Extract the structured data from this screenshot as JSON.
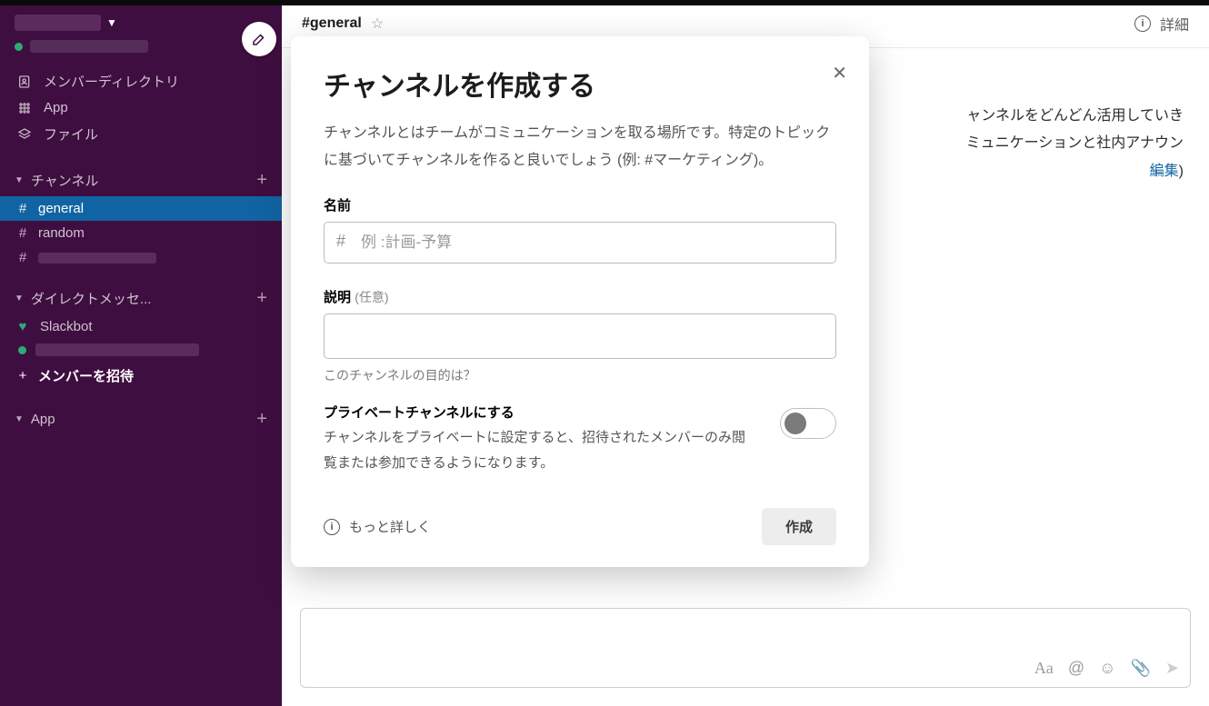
{
  "sidebar": {
    "nav": {
      "members": "メンバーディレクトリ",
      "apps": "App",
      "files": "ファイル"
    },
    "sections": {
      "channels_heading": "チャンネル",
      "dms_heading": "ダイレクトメッセ...",
      "apps_heading": "App"
    },
    "channels": [
      {
        "label": "general",
        "active": true
      },
      {
        "label": "random",
        "active": false
      },
      {
        "label": "",
        "active": false,
        "blurred": true
      }
    ],
    "dms": {
      "slackbot": "Slackbot"
    },
    "invite": "メンバーを招待"
  },
  "header": {
    "channel_name": "#general",
    "details": "詳細"
  },
  "channel_intro": {
    "line1_suffix": "ャンネルをどんどん活用していき",
    "line2_suffix": "ミュニケーションと社内アナウン",
    "edit": "編集",
    "close_paren": ")"
  },
  "composer": {
    "aa": "Aa",
    "at": "@",
    "emoji": "☺",
    "attach": "📎",
    "send": "➤"
  },
  "modal": {
    "title": "チャンネルを作成する",
    "description": "チャンネルとはチームがコミュニケーションを取る場所です。特定のトピックに基づいてチャンネルを作ると良いでしょう (例: #マーケティング)。",
    "name_label": "名前",
    "name_placeholder": "例 :計画-予算",
    "desc_label": "説明",
    "desc_optional": "(任意)",
    "desc_helper": "このチャンネルの目的は？",
    "private_title": "プライベートチャンネルにする",
    "private_sub": "チャンネルをプライベートに設定すると、招待されたメンバーのみ閲覧または参加できるようになります。",
    "learn_more": "もっと詳しく",
    "create": "作成"
  }
}
